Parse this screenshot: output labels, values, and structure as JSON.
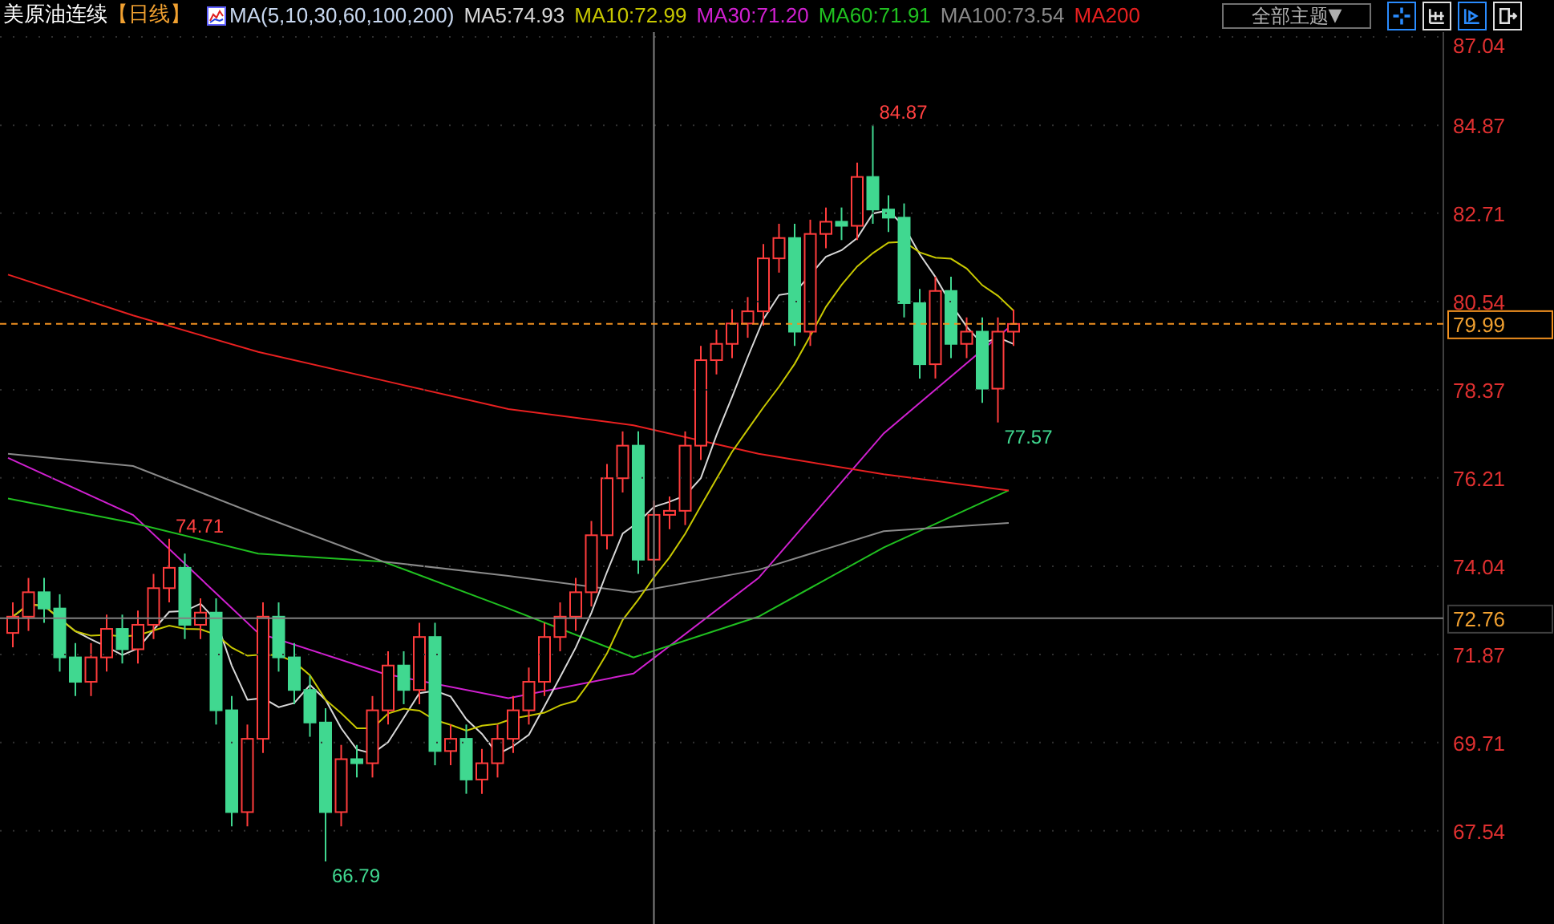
{
  "header": {
    "title": "美原油连续",
    "period": "【日线】",
    "indicator": "MA(5,10,30,60,100,200)",
    "ma_readings": [
      {
        "label": "MA5:74.93",
        "color": "#d8d8d8"
      },
      {
        "label": "MA10:72.99",
        "color": "#c8c800"
      },
      {
        "label": "MA30:71.20",
        "color": "#d020d0"
      },
      {
        "label": "MA60:71.91",
        "color": "#20c020"
      },
      {
        "label": "MA100:73.54",
        "color": "#8a8a8a"
      },
      {
        "label": "MA200",
        "color": "#e82020"
      }
    ],
    "theme_dropdown": {
      "label": "全部主题",
      "caret": "▼"
    },
    "toolbar": [
      {
        "selected": true
      },
      {
        "selected": false
      },
      {
        "selected": true
      },
      {
        "selected": false
      }
    ]
  },
  "chart": {
    "y_axis_labels": [
      "87.04",
      "84.87",
      "82.71",
      "80.54",
      "78.37",
      "76.21",
      "74.04",
      "71.87",
      "69.71",
      "67.54"
    ],
    "last_price_tag": "79.99",
    "crosshair_price_tag": "72.76",
    "price_labels": [
      {
        "label": "74.71",
        "kind": "high"
      },
      {
        "label": "66.79",
        "kind": "low"
      },
      {
        "label": "84.87",
        "kind": "high"
      },
      {
        "label": "77.57",
        "kind": "low"
      }
    ]
  }
}
